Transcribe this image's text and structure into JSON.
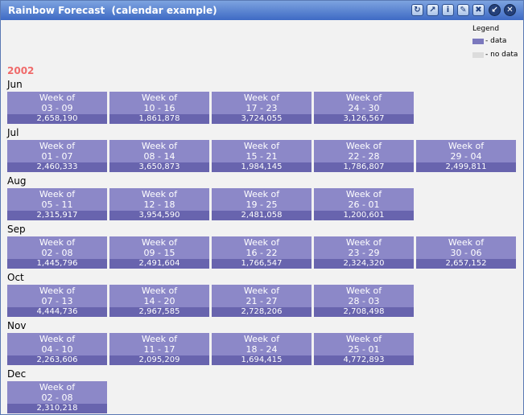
{
  "window": {
    "title": "Rainbow Forecast  (calendar example)"
  },
  "legend": {
    "title": "Legend",
    "items": [
      {
        "label": "- data",
        "color": "#7b78bd"
      },
      {
        "label": "- no data",
        "color": "#dcdcdc"
      }
    ]
  },
  "calendar": {
    "year": "2002",
    "months": [
      {
        "name": "Jun",
        "weeks": [
          {
            "label": "Week of",
            "range": "03 - 09",
            "value": "2,658,190"
          },
          {
            "label": "Week of",
            "range": "10 - 16",
            "value": "1,861,878"
          },
          {
            "label": "Week of",
            "range": "17 - 23",
            "value": "3,724,055"
          },
          {
            "label": "Week of",
            "range": "24 - 30",
            "value": "3,126,567"
          }
        ]
      },
      {
        "name": "Jul",
        "weeks": [
          {
            "label": "Week of",
            "range": "01 - 07",
            "value": "2,460,333"
          },
          {
            "label": "Week of",
            "range": "08 - 14",
            "value": "3,650,873"
          },
          {
            "label": "Week of",
            "range": "15 - 21",
            "value": "1,984,145"
          },
          {
            "label": "Week of",
            "range": "22 - 28",
            "value": "1,786,807"
          },
          {
            "label": "Week of",
            "range": "29 - 04",
            "value": "2,499,811"
          }
        ]
      },
      {
        "name": "Aug",
        "weeks": [
          {
            "label": "Week of",
            "range": "05 - 11",
            "value": "2,315,917"
          },
          {
            "label": "Week of",
            "range": "12 - 18",
            "value": "3,954,590"
          },
          {
            "label": "Week of",
            "range": "19 - 25",
            "value": "2,481,058"
          },
          {
            "label": "Week of",
            "range": "26 - 01",
            "value": "1,200,601"
          }
        ]
      },
      {
        "name": "Sep",
        "weeks": [
          {
            "label": "Week of",
            "range": "02 - 08",
            "value": "1,445,796"
          },
          {
            "label": "Week of",
            "range": "09 - 15",
            "value": "2,491,604"
          },
          {
            "label": "Week of",
            "range": "16 - 22",
            "value": "1,766,547"
          },
          {
            "label": "Week of",
            "range": "23 - 29",
            "value": "2,324,320"
          },
          {
            "label": "Week of",
            "range": "30 - 06",
            "value": "2,657,152"
          }
        ]
      },
      {
        "name": "Oct",
        "weeks": [
          {
            "label": "Week of",
            "range": "07 - 13",
            "value": "4,444,736"
          },
          {
            "label": "Week of",
            "range": "14 - 20",
            "value": "2,967,585"
          },
          {
            "label": "Week of",
            "range": "21 - 27",
            "value": "2,728,206"
          },
          {
            "label": "Week of",
            "range": "28 - 03",
            "value": "2,708,498"
          }
        ]
      },
      {
        "name": "Nov",
        "weeks": [
          {
            "label": "Week of",
            "range": "04 - 10",
            "value": "2,263,606"
          },
          {
            "label": "Week of",
            "range": "11 - 17",
            "value": "2,095,209"
          },
          {
            "label": "Week of",
            "range": "18 - 24",
            "value": "1,694,415"
          },
          {
            "label": "Week of",
            "range": "25 - 01",
            "value": "4,772,893"
          }
        ]
      },
      {
        "name": "Dec",
        "weeks": [
          {
            "label": "Week of",
            "range": "02 - 08",
            "value": "2,310,218"
          }
        ]
      }
    ]
  }
}
